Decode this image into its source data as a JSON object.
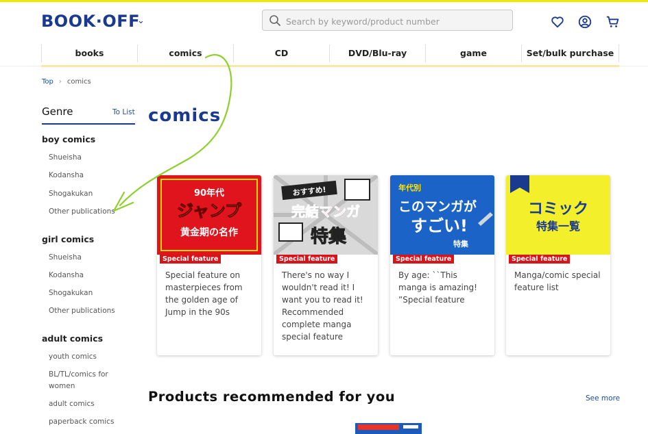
{
  "header": {
    "logo_text": "BOOK·OFF",
    "search_placeholder": "Search by keyword/product number"
  },
  "nav": {
    "items": [
      "books",
      "comics",
      "CD",
      "DVD/Blu-ray",
      "game",
      "Set/bulk purchase"
    ]
  },
  "breadcrumb": {
    "top": "Top",
    "current": "comics"
  },
  "sidebar": {
    "title": "Genre",
    "to_list": "To List",
    "groups": [
      {
        "heading": "boy comics",
        "items": [
          "Shueisha",
          "Kodansha",
          "Shogakukan",
          "Other publications"
        ]
      },
      {
        "heading": "girl comics",
        "items": [
          "Shueisha",
          "Kodansha",
          "Shogakukan",
          "Other publications"
        ]
      },
      {
        "heading": "adult comics",
        "items": [
          "youth comics",
          "BL/TL/comics for women",
          "adult comics",
          "paperback comics"
        ]
      }
    ]
  },
  "main": {
    "title": "comics",
    "cards": [
      {
        "tag": "Special feature",
        "text": "Special feature on masterpieces from the golden age of Jump in the 90s",
        "img": {
          "line1": "90年代",
          "line2": "ジャンプ",
          "line3": "黄金期の名作"
        }
      },
      {
        "tag": "Special feature",
        "text": "There's no way I wouldn't read it! I want you to read it! Recommended complete manga special feature",
        "img": {
          "line1": "おすすめ!",
          "line2": "完結マンガ",
          "line3": "特集"
        }
      },
      {
        "tag": "Special feature",
        "text": "By age: ``This manga is amazing! ”Special feature",
        "img": {
          "line1": "年代別",
          "line2": "このマンガが",
          "line3": "すごい!",
          "line4": "特集"
        }
      },
      {
        "tag": "Special feature",
        "text": "Manga/comic special feature list",
        "img": {
          "line1": "コミック",
          "line2": "特集一覧"
        }
      }
    ],
    "recommend_title": "Products recommended for you",
    "see_more": "See more"
  },
  "colors": {
    "brand_blue": "#1a3a8f",
    "tag_red": "#d8141b",
    "top_yellow": "#f2e800",
    "annotation_green": "#8ed02a"
  }
}
